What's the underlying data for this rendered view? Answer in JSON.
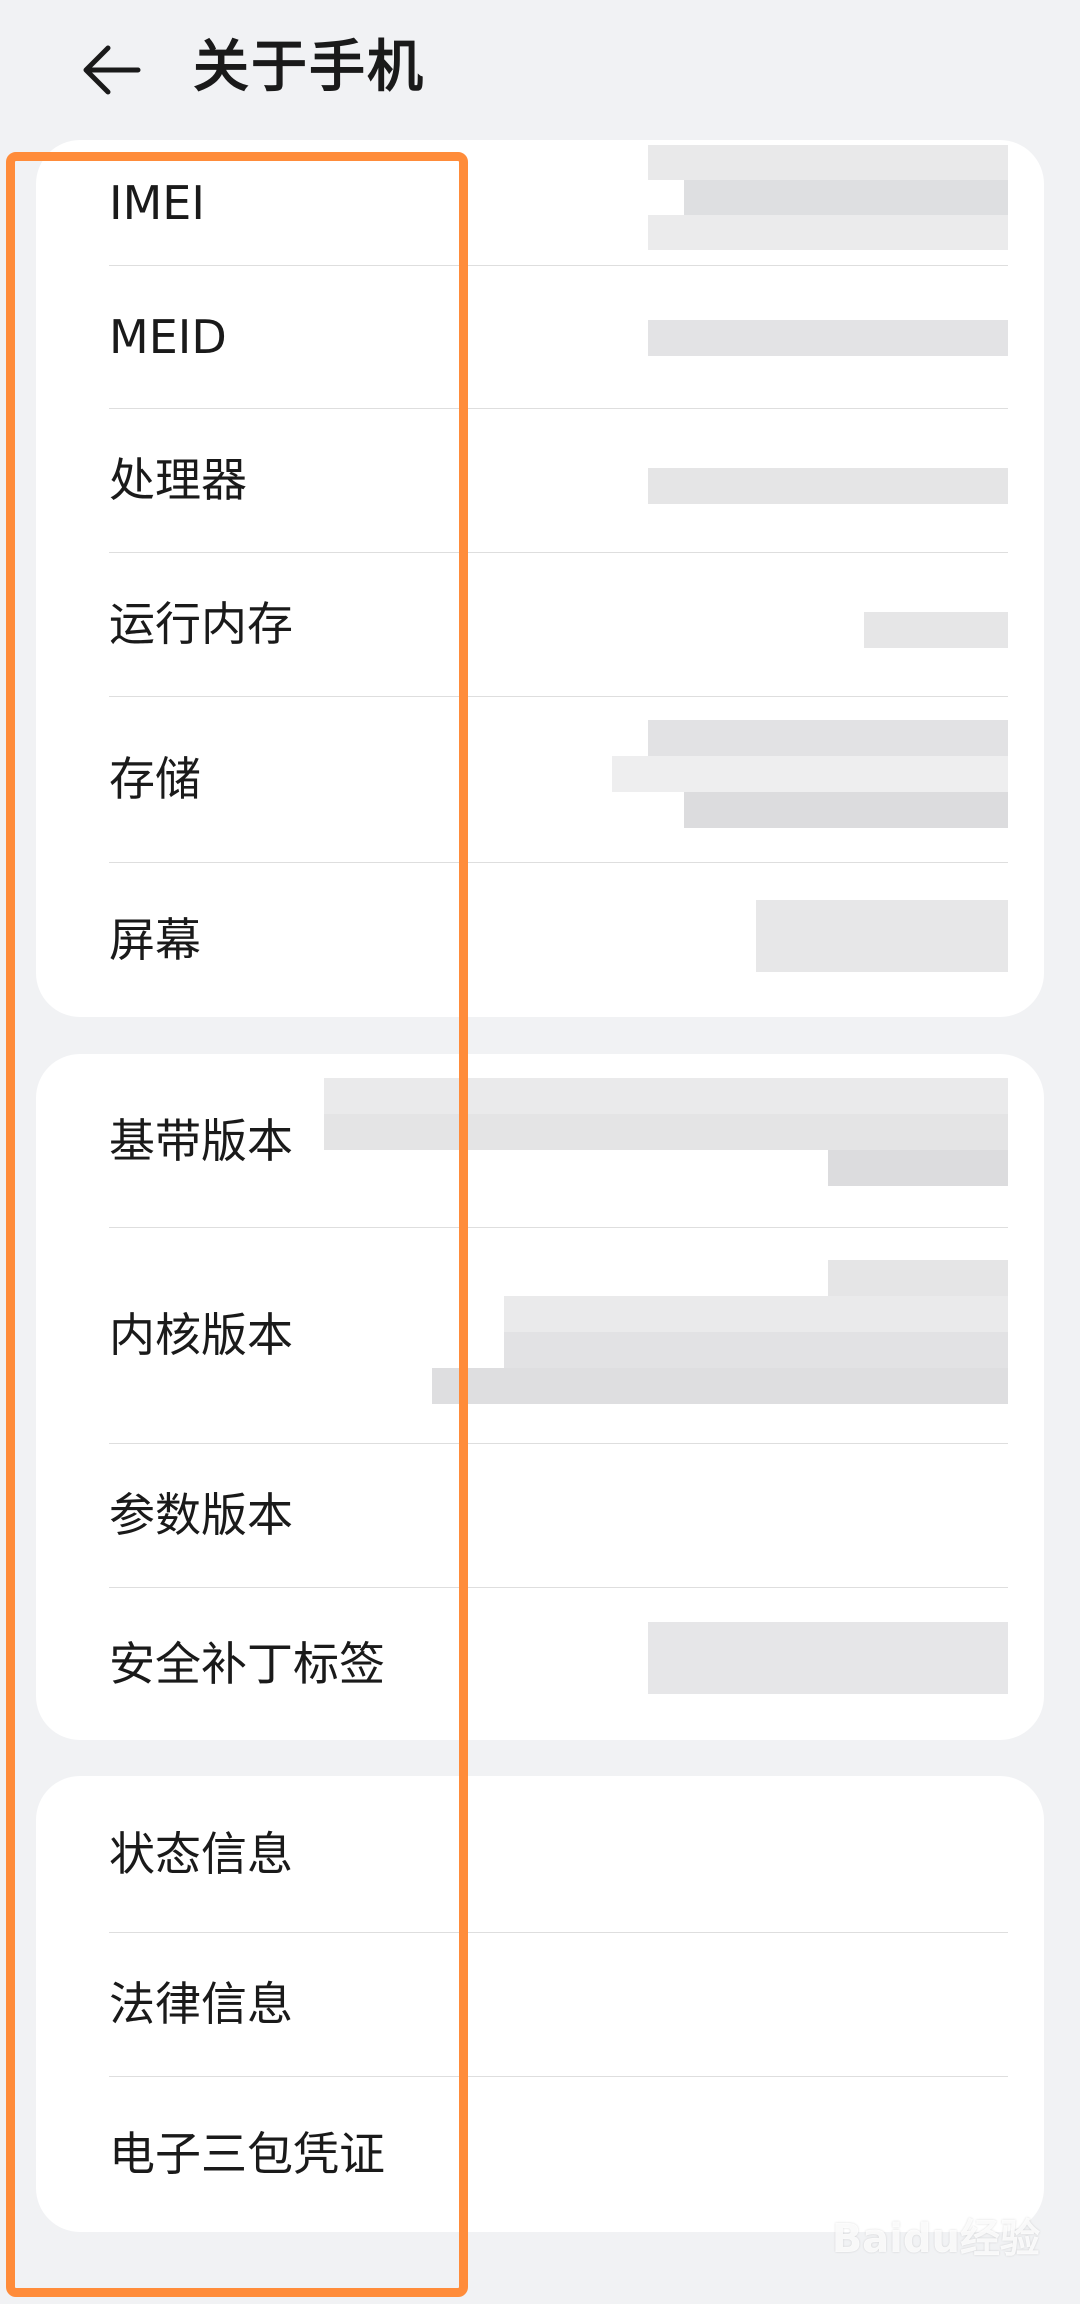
{
  "header": {
    "title": "关于手机"
  },
  "groups": [
    {
      "items": [
        "IMEI",
        "MEID",
        "处理器",
        "运行内存",
        "存储",
        "屏幕"
      ]
    },
    {
      "items": [
        "基带版本",
        "内核版本",
        "参数版本",
        "安全补丁标签"
      ]
    },
    {
      "items": [
        "状态信息",
        "法律信息",
        "电子三包凭证"
      ]
    }
  ],
  "watermark": "Baidu经验",
  "colors": {
    "background": "#f1f2f4",
    "card": "#ffffff",
    "highlight": "#ff8c3a"
  },
  "icons": {
    "back": "arrow-left-icon"
  }
}
